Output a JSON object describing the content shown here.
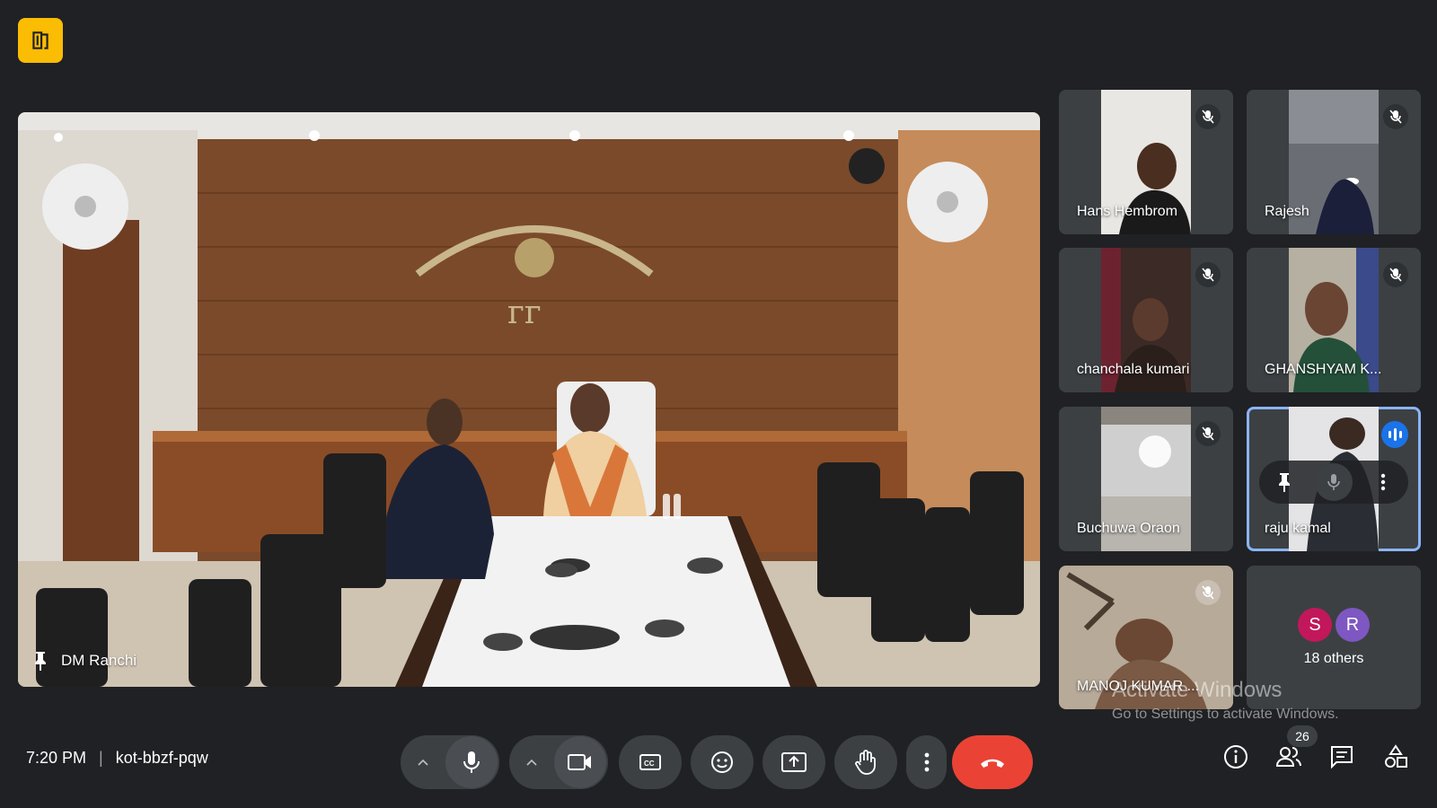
{
  "logo_icon": "office-building-icon",
  "main_speaker": {
    "name": "DM Ranchi",
    "pin_icon": "pin-icon"
  },
  "participants": [
    {
      "name": "Hans Hembrom",
      "muted": true
    },
    {
      "name": "Rajesh",
      "muted": true
    },
    {
      "name": "chanchala kumari",
      "muted": true
    },
    {
      "name": "GHANSHYAM K...",
      "muted": true
    },
    {
      "name": "Buchuwa Oraon",
      "muted": true
    },
    {
      "name": "raju kamal",
      "speaking": true
    },
    {
      "name": "MANOJ KUMAR ...",
      "muted": true
    }
  ],
  "others": {
    "label": "18 others",
    "avatars": [
      "S",
      "R"
    ],
    "avatar_colors": [
      "#c2185b",
      "#7e57c2"
    ]
  },
  "watermark": {
    "line1": "Activate Windows",
    "line2": "Go to Settings to activate Windows."
  },
  "meeting": {
    "time": "7:20 PM",
    "separator": "|",
    "code": "kot-bbzf-pqw"
  },
  "controls": {
    "mic": "microphone-icon",
    "camera": "camera-icon",
    "captions": "captions-icon",
    "emoji": "emoji-icon",
    "present": "present-screen-icon",
    "raise_hand": "raise-hand-icon",
    "more": "more-options-icon",
    "end_call": "end-call-icon"
  },
  "right_toolbar": {
    "participants_count": "26"
  },
  "colors": {
    "background": "#202124",
    "tile": "#3c4043",
    "accent": "#1a73e8",
    "end_call": "#ea4335",
    "logo": "#fbbc04"
  }
}
